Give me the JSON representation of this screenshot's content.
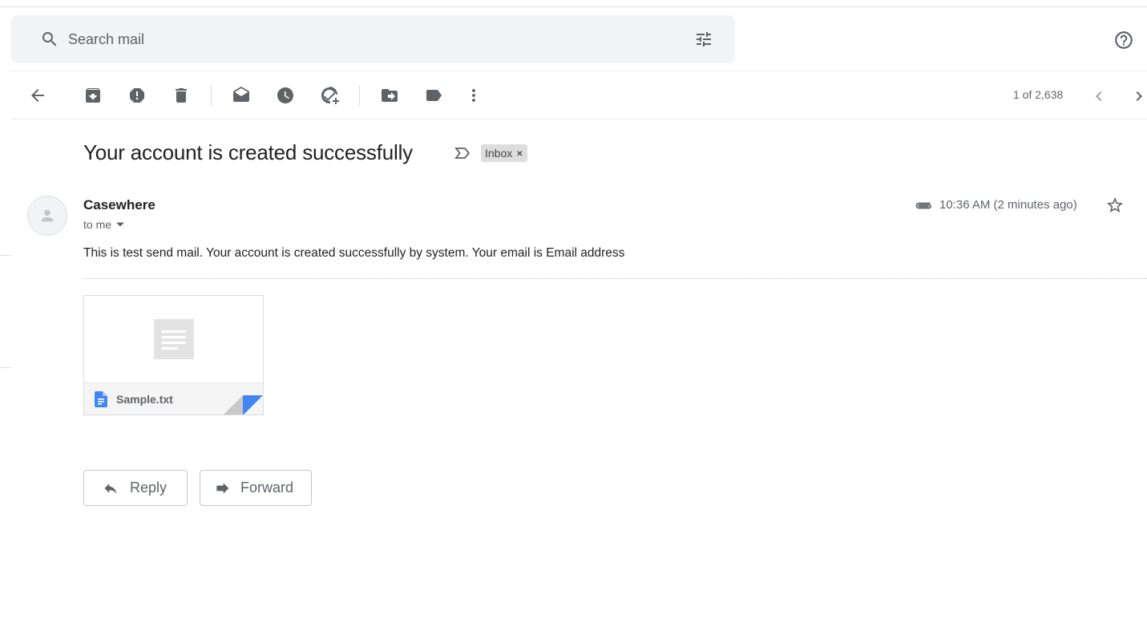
{
  "search": {
    "placeholder": "Search mail"
  },
  "toolbar": {
    "pager": "1 of 2,638"
  },
  "email": {
    "subject": "Your account is created successfully",
    "label": "Inbox",
    "label_remove": "×",
    "sender": "Casewhere",
    "recipient": "to me",
    "time": "10:36 AM (2 minutes ago)",
    "body": "This is test send mail. Your account is created successfully by system. Your email is Email address"
  },
  "attachment": {
    "file_name": "Sample.txt"
  },
  "actions": {
    "reply": "Reply",
    "forward": "Forward"
  },
  "icons": {
    "search": "search-icon",
    "tune": "tune-icon",
    "help": "help-icon",
    "back": "arrow-back-icon",
    "archive": "archive-icon",
    "spam": "report-spam-icon",
    "delete": "delete-icon",
    "mark_unread": "mark-unread-icon",
    "snooze": "snooze-icon",
    "add_task": "add-to-tasks-icon",
    "move": "move-to-icon",
    "labels": "label-icon",
    "more": "more-vert-icon",
    "prev": "chevron-left-icon",
    "next": "chevron-right-icon",
    "importance": "importance-marker-icon",
    "attach": "paperclip-icon",
    "star": "star-icon"
  },
  "colors": {
    "accent_blue": "#4285f4",
    "icon_gray": "#5f6368",
    "search_bg": "#f1f3f4"
  }
}
